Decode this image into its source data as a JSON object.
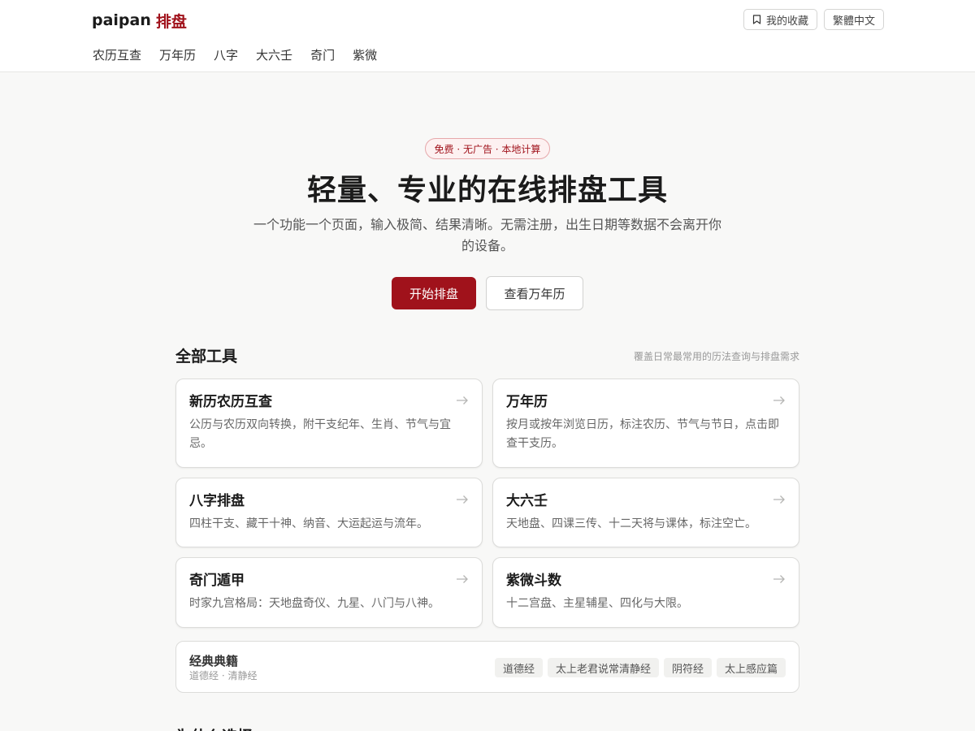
{
  "brand": {
    "en": "paipan",
    "zh": "排盘"
  },
  "header_actions": {
    "favorites": "我的收藏",
    "language": "繁體中文"
  },
  "nav": [
    "农历互查",
    "万年历",
    "八字",
    "大六壬",
    "奇门",
    "紫微"
  ],
  "hero": {
    "badge": "免费 · 无广告 · 本地计算",
    "title": "轻量、专业的在线排盘工具",
    "subtitle": "一个功能一个页面，输入极简、结果清晰。无需注册，出生日期等数据不会离开你的设备。",
    "primary_button": "开始排盘",
    "secondary_button": "查看万年历"
  },
  "tools_section": {
    "title": "全部工具",
    "note": "覆盖日常最常用的历法查询与排盘需求",
    "cards": [
      {
        "title": "新历农历互查",
        "desc": "公历与农历双向转换，附干支纪年、生肖、节气与宜忌。"
      },
      {
        "title": "万年历",
        "desc": "按月或按年浏览日历，标注农历、节气与节日，点击即查干支历。"
      },
      {
        "title": "八字排盘",
        "desc": "四柱干支、藏干十神、纳音、大运起运与流年。"
      },
      {
        "title": "大六壬",
        "desc": "天地盘、四课三传、十二天将与课体，标注空亡。"
      },
      {
        "title": "奇门遁甲",
        "desc": "时家九宫格局：天地盘奇仪、九星、八门与八神。"
      },
      {
        "title": "紫微斗数",
        "desc": "十二宫盘、主星辅星、四化与大限。"
      }
    ]
  },
  "classics": {
    "title": "经典典籍",
    "subtitle": "道德经 · 清静经",
    "tags": [
      "道德经",
      "太上老君说常清静经",
      "阴符经",
      "太上感应篇"
    ]
  },
  "next_section": {
    "title": "为什么选择"
  },
  "colors": {
    "accent": "#a0121b",
    "background": "#f8f8f7"
  },
  "icons": {
    "favorites": "bookmark-icon",
    "card_link": "arrow-right-icon"
  }
}
